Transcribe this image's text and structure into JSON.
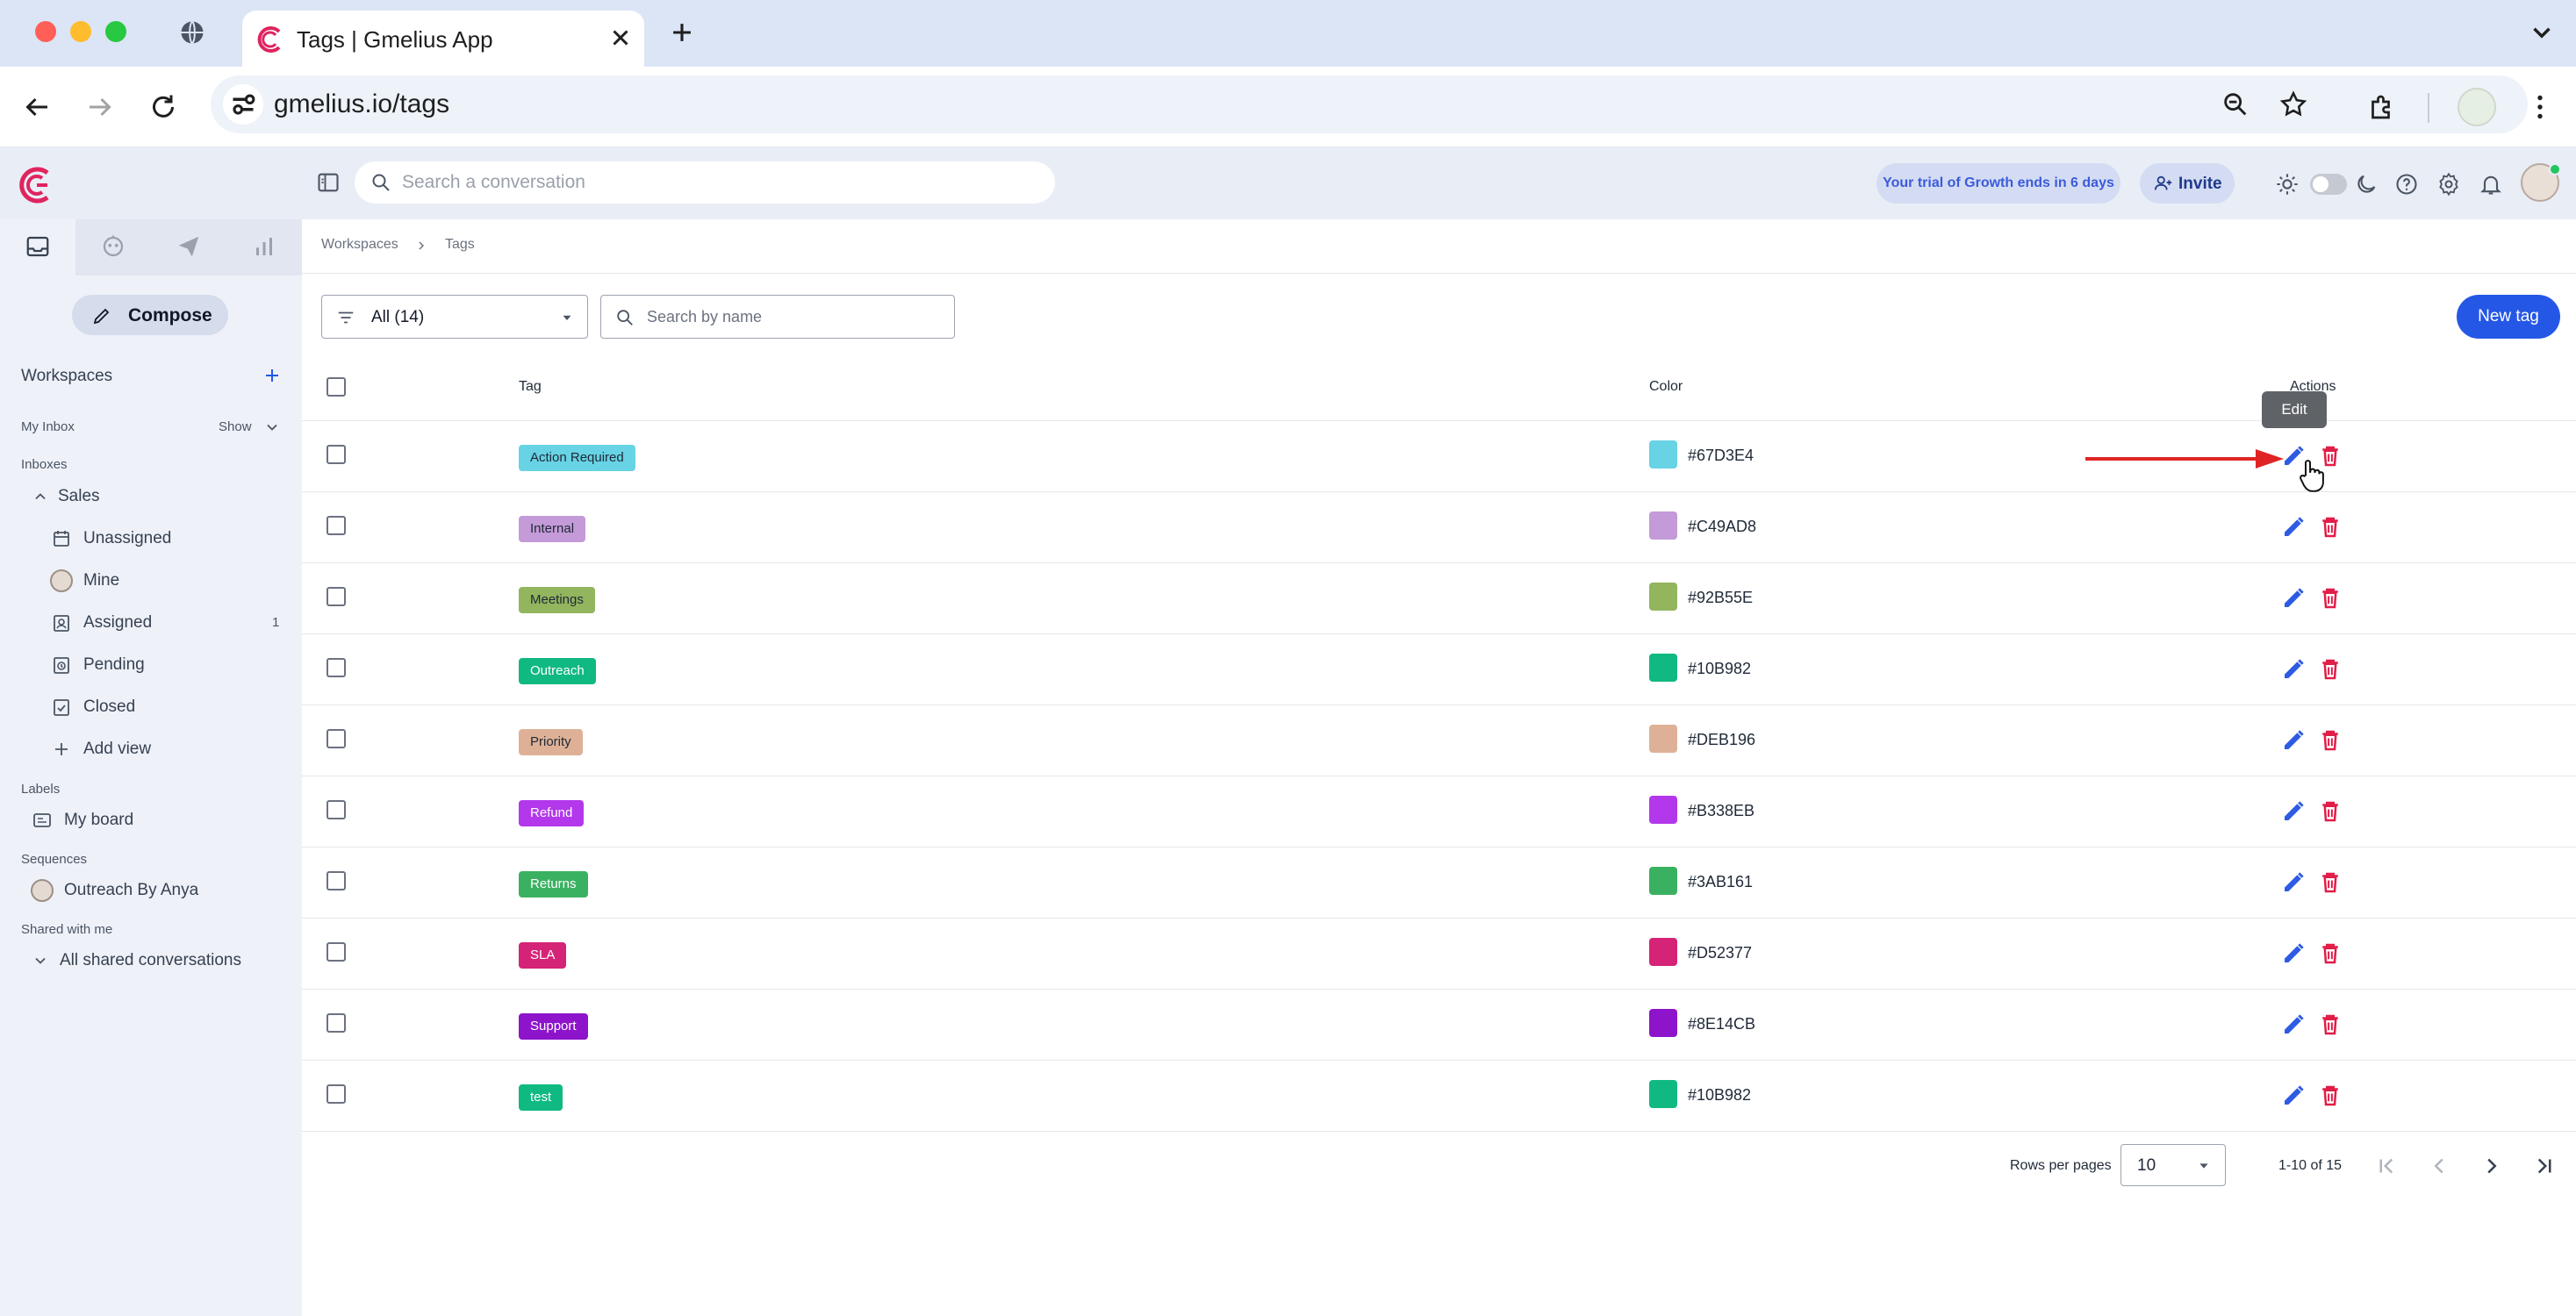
{
  "browser": {
    "tab_title": "Tags | Gmelius App",
    "url": "gmelius.io/tags"
  },
  "app_header": {
    "search_placeholder": "Search a conversation",
    "trial_badge": "Your trial of Growth ends in 6 days",
    "invite_label": "Invite"
  },
  "sidebar": {
    "compose_label": "Compose",
    "workspaces_label": "Workspaces",
    "my_inbox_label": "My Inbox",
    "my_inbox_toggle": "Show",
    "inboxes_label": "Inboxes",
    "sales_label": "Sales",
    "items": [
      {
        "label": "Unassigned",
        "icon": "unassigned-icon",
        "count": ""
      },
      {
        "label": "Mine",
        "icon": "avatar",
        "count": ""
      },
      {
        "label": "Assigned",
        "icon": "assigned-icon",
        "count": "1"
      },
      {
        "label": "Pending",
        "icon": "pending-icon",
        "count": ""
      },
      {
        "label": "Closed",
        "icon": "closed-icon",
        "count": ""
      },
      {
        "label": "Add view",
        "icon": "plus-icon",
        "count": ""
      }
    ],
    "labels_label": "Labels",
    "board_label": "My board",
    "sequences_label": "Sequences",
    "sequence_item": "Outreach By Anya",
    "shared_label": "Shared with me",
    "shared_item": "All shared conversations"
  },
  "breadcrumb": {
    "root": "Workspaces",
    "current": "Tags"
  },
  "toolbar": {
    "filter_value": "All (14)",
    "search_placeholder": "Search by name",
    "new_tag_label": "New tag"
  },
  "table": {
    "headers": {
      "tag": "Tag",
      "color": "Color",
      "actions": "Actions"
    },
    "rows": [
      {
        "tag": "Action Required",
        "hex": "#67D3E4"
      },
      {
        "tag": "Internal",
        "hex": "#C49AD8"
      },
      {
        "tag": "Meetings",
        "hex": "#92B55E"
      },
      {
        "tag": "Outreach",
        "hex": "#10B982"
      },
      {
        "tag": "Priority",
        "hex": "#DEB196"
      },
      {
        "tag": "Refund",
        "hex": "#B338EB"
      },
      {
        "tag": "Returns",
        "hex": "#3AB161"
      },
      {
        "tag": "SLA",
        "hex": "#D52377"
      },
      {
        "tag": "Support",
        "hex": "#8E14CB"
      },
      {
        "tag": "test",
        "hex": "#10B982"
      }
    ]
  },
  "tooltip": "Edit",
  "pagination": {
    "rows_per_page_label": "Rows per pages",
    "rows_per_page_value": "10",
    "range": "1-10 of 15"
  },
  "colors": {
    "brand": "#E0245E",
    "primary_button": "#2557E6",
    "edit_icon": "#2D5BE3",
    "delete_icon": "#E11D48",
    "annotation_arrow": "#E02424"
  }
}
